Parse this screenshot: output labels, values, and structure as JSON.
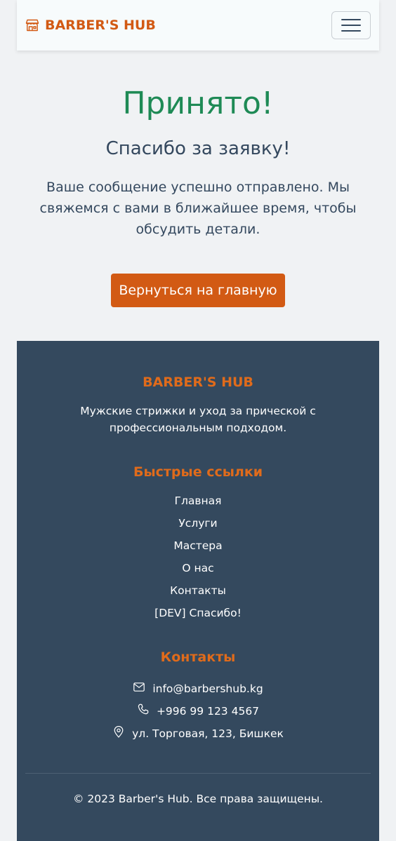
{
  "header": {
    "brand": "BARBER'S HUB",
    "brand_icon": "shop-icon",
    "menu_icon": "hamburger-icon"
  },
  "main": {
    "title": "Принято!",
    "subtitle": "Спасибо за заявку!",
    "message": "Ваше сообщение успешно отправлено. Мы свяжемся с вами в ближайшее время, чтобы обсудить детали.",
    "back_button": "Вернуться на главную"
  },
  "footer": {
    "brand": "BARBER'S HUB",
    "description": "Мужские стрижки и уход за прической с профессиональным подходом.",
    "links_title": "Быстрые ссылки",
    "links": [
      "Главная",
      "Услуги",
      "Мастера",
      "О нас",
      "Контакты",
      "[DEV] Спасибо!"
    ],
    "contacts_title": "Контакты",
    "contacts": {
      "email": "info@barbershub.kg",
      "phone": "+996 99 123 4567",
      "address": "ул. Торговая, 123, Бишкек"
    },
    "copyright": "© 2023 Barber's Hub. Все права защищены."
  },
  "colors": {
    "accent": "#d25a14",
    "footer_heading": "#e06b1b",
    "success": "#1e8a55",
    "text": "#34485e",
    "footer_bg": "#34495e",
    "page_bg": "#f0f2f4"
  }
}
